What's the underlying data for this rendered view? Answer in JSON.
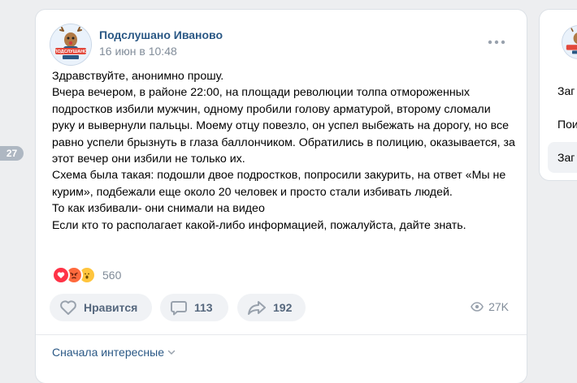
{
  "sidebar_counter": "27",
  "post": {
    "group_name": "Подслушано Иваново",
    "date": "16 июн в 10:48",
    "avatar_caption": "ПОДСЛУШАНО",
    "text": [
      "Здравствуйте, анонимно прошу.",
      "Вчера вечером, в районе 22:00, на площади революции толпа отмороженных подростков избили мужчин, одному пробили голову арматурой, второму сломали руку и вывернули пальцы. Моему отцу повезло, он успел выбежать на дорогу, но все равно успели брызнуть в глаза баллончиком. Обратились в полицию, оказывается, за этот вечер они избили не только их.",
      "Схема была такая: подошли двое подростков, попросили закурить, на ответ «Мы не курим», подбежали еще около 20 человек и просто стали избивать людей.",
      "То как избивали- они снимали на видео",
      "Если кто то располагает какой-либо информацией, пожалуйста, дайте знать."
    ],
    "reactions": {
      "icons": [
        "heart-reaction",
        "angry-reaction",
        "surprised-reaction"
      ],
      "count": "560"
    },
    "actions": {
      "like_label": "Нравится",
      "comments_count": "113",
      "shares_count": "192"
    },
    "views": "27K",
    "sort_label": "Сначала интересные"
  },
  "side_panel": {
    "items": [
      "Заг",
      "Пои",
      "Заг"
    ]
  },
  "colors": {
    "link": "#2a5885",
    "secondary_text": "#818c99",
    "button_bg": "#f0f2f5",
    "page_bg": "#edeef0"
  }
}
